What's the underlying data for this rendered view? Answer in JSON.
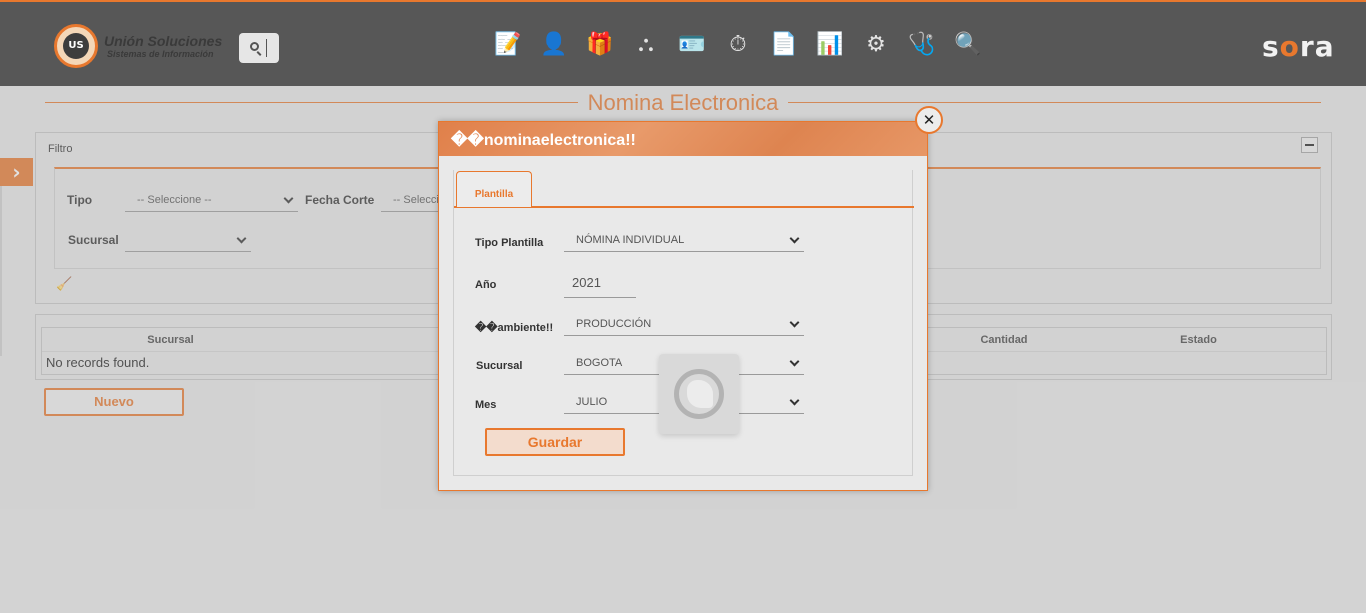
{
  "header": {
    "logo_name": "Unión Soluciones",
    "logo_sub": "Sistemas de Información",
    "logo_mark": "US",
    "brand_pre": "s",
    "brand_accent": "o",
    "brand_post": "ra",
    "nav_icons": [
      {
        "name": "document-edit-icon",
        "glyph": "📝"
      },
      {
        "name": "user-person-icon",
        "glyph": "👤"
      },
      {
        "name": "gift-icon",
        "glyph": "🎁"
      },
      {
        "name": "hierarchy-icon",
        "glyph": "⛬"
      },
      {
        "name": "employee-card-icon",
        "glyph": "🪪"
      },
      {
        "name": "stopwatch-icon",
        "glyph": "⏱"
      },
      {
        "name": "report-icon",
        "glyph": "📄"
      },
      {
        "name": "presentation-icon",
        "glyph": "📊"
      },
      {
        "name": "gears-icon",
        "glyph": "⚙"
      },
      {
        "name": "medical-shield-icon",
        "glyph": "🩺"
      },
      {
        "name": "user-search-icon",
        "glyph": "🔍"
      }
    ]
  },
  "page": {
    "title": "Nomina Electronica"
  },
  "filter": {
    "title": "Filtro",
    "tipo_label": "Tipo",
    "tipo_value": "-- Seleccione --",
    "fecha_label": "Fecha Corte",
    "fecha_value": "-- Seleccione --",
    "sucursal_label": "Sucursal",
    "sucursal_value": ""
  },
  "table": {
    "columns": [
      "Sucursal",
      "Cantidad",
      "Estado"
    ],
    "empty_text": "No records found."
  },
  "buttons": {
    "nuevo": "Nuevo",
    "guardar": "Guardar"
  },
  "dialog": {
    "title": "��nominaelectronica!!",
    "tab_label": "Plantilla",
    "fields": {
      "tipo_plantilla_label": "Tipo Plantilla",
      "tipo_plantilla_value": "NÓMINA INDIVIDUAL",
      "anio_label": "Año",
      "anio_value": "2021",
      "ambiente_label": "��ambiente!!",
      "ambiente_value": "PRODUCCIÓN",
      "sucursal_label": "Sucursal",
      "sucursal_value": "BOGOTA",
      "mes_label": "Mes",
      "mes_value": "JULIO"
    }
  },
  "colors": {
    "accent": "#e8782e",
    "header_bg": "#575757"
  }
}
